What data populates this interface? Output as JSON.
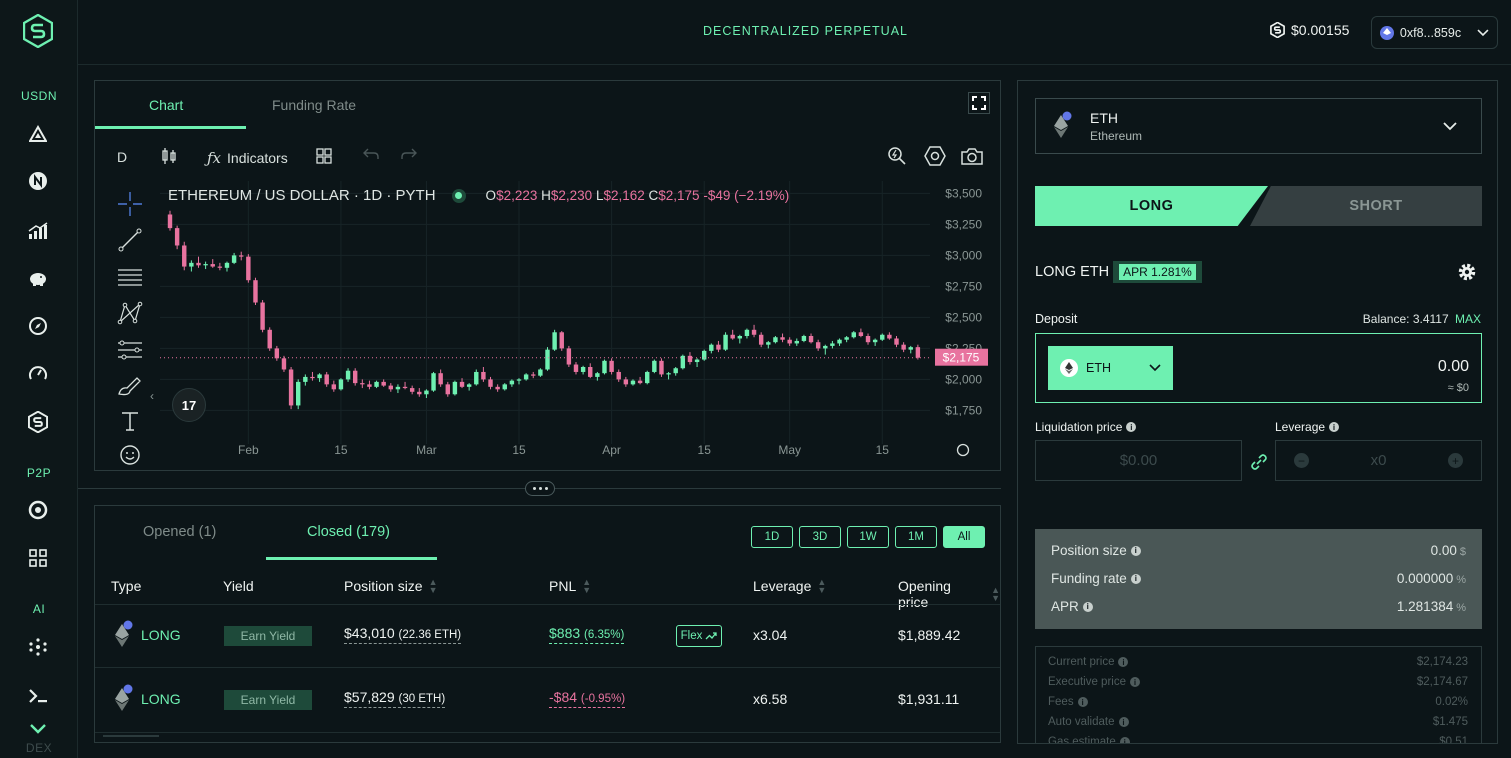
{
  "app": {
    "title": "DECENTRALIZED PERPETUAL",
    "balance": "$0.00155",
    "wallet": "0xf8...859c"
  },
  "sidebar": {
    "sections": [
      "USDN",
      "P2P",
      "AI",
      "DEX"
    ]
  },
  "chart_panel": {
    "tabs": [
      "Chart",
      "Funding Rate"
    ],
    "active_tab": "Chart",
    "toolbar": {
      "interval": "D",
      "indicators_label": "Indicators"
    },
    "legend": {
      "symbol": "ETHEREUM / US DOLLAR · 1D · PYTH",
      "o_label": "O",
      "o": "$2,223",
      "h_label": "H",
      "h": "$2,230",
      "l_label": "L",
      "l": "$2,162",
      "c_label": "C",
      "c": "$2,175",
      "change": "-$49 (−2.19%)"
    },
    "price_tag": "$2,175",
    "tv_logo": "17"
  },
  "chart_data": {
    "type": "candlestick",
    "title": "ETHEREUM / US DOLLAR · 1D · PYTH",
    "y_ticks": [
      "$3,500",
      "$3,250",
      "$3,000",
      "$2,750",
      "$2,500",
      "$2,250",
      "$2,000",
      "$1,750"
    ],
    "y_tick_values": [
      3500,
      3250,
      3000,
      2750,
      2500,
      2250,
      2000,
      1750
    ],
    "x_ticks": [
      "Feb",
      "15",
      "Mar",
      "15",
      "Apr",
      "15",
      "May",
      "15"
    ],
    "ylim": [
      1600,
      3600
    ],
    "current_price": 2175,
    "up_color": "#6ef0b1",
    "down_color": "#e8739f",
    "candles": [
      [
        3330,
        3360,
        3200,
        3220
      ],
      [
        3220,
        3240,
        3050,
        3080
      ],
      [
        3080,
        3110,
        2880,
        2910
      ],
      [
        2910,
        2960,
        2870,
        2940
      ],
      [
        2940,
        2990,
        2900,
        2920
      ],
      [
        2920,
        2950,
        2890,
        2930
      ],
      [
        2930,
        2970,
        2900,
        2910
      ],
      [
        2910,
        2940,
        2880,
        2900
      ],
      [
        2900,
        2950,
        2870,
        2940
      ],
      [
        2940,
        3020,
        2930,
        3000
      ],
      [
        3000,
        3030,
        2960,
        2990
      ],
      [
        2990,
        3010,
        2780,
        2800
      ],
      [
        2800,
        2820,
        2600,
        2620
      ],
      [
        2620,
        2640,
        2380,
        2400
      ],
      [
        2400,
        2420,
        2230,
        2250
      ],
      [
        2250,
        2270,
        2150,
        2170
      ],
      [
        2170,
        2190,
        2060,
        2080
      ],
      [
        2080,
        2100,
        1760,
        1790
      ],
      [
        1790,
        2000,
        1760,
        1980
      ],
      [
        1980,
        2040,
        1950,
        2020
      ],
      [
        2020,
        2060,
        1990,
        2010
      ],
      [
        2010,
        2050,
        1980,
        2040
      ],
      [
        2040,
        2060,
        1940,
        1960
      ],
      [
        1960,
        1990,
        1900,
        1920
      ],
      [
        1920,
        2010,
        1910,
        2000
      ],
      [
        2000,
        2090,
        1980,
        2070
      ],
      [
        2070,
        2090,
        1950,
        1970
      ],
      [
        1970,
        2000,
        1930,
        1960
      ],
      [
        1960,
        1990,
        1920,
        1940
      ],
      [
        1940,
        1990,
        1930,
        1980
      ],
      [
        1980,
        2000,
        1940,
        1950
      ],
      [
        1950,
        1970,
        1900,
        1920
      ],
      [
        1920,
        1960,
        1890,
        1940
      ],
      [
        1940,
        1980,
        1920,
        1930
      ],
      [
        1930,
        1950,
        1880,
        1900
      ],
      [
        1900,
        1930,
        1860,
        1880
      ],
      [
        1880,
        1920,
        1850,
        1910
      ],
      [
        1910,
        2060,
        1900,
        2050
      ],
      [
        2050,
        2080,
        1940,
        1960
      ],
      [
        1960,
        1980,
        1860,
        1880
      ],
      [
        1880,
        1990,
        1870,
        1980
      ],
      [
        1980,
        2010,
        1930,
        1940
      ],
      [
        1940,
        1970,
        1910,
        1960
      ],
      [
        1960,
        2080,
        1950,
        2060
      ],
      [
        2060,
        2100,
        1980,
        2000
      ],
      [
        2000,
        2020,
        1920,
        1940
      ],
      [
        1940,
        1960,
        1900,
        1920
      ],
      [
        1920,
        1970,
        1910,
        1960
      ],
      [
        1960,
        2000,
        1940,
        1990
      ],
      [
        1990,
        2010,
        1960,
        2000
      ],
      [
        2000,
        2050,
        1990,
        2040
      ],
      [
        2040,
        2060,
        2010,
        2030
      ],
      [
        2030,
        2090,
        2020,
        2080
      ],
      [
        2080,
        2260,
        2070,
        2240
      ],
      [
        2240,
        2400,
        2230,
        2380
      ],
      [
        2380,
        2390,
        2230,
        2250
      ],
      [
        2250,
        2270,
        2100,
        2120
      ],
      [
        2120,
        2140,
        2040,
        2060
      ],
      [
        2060,
        2110,
        2040,
        2100
      ],
      [
        2100,
        2130,
        2010,
        2020
      ],
      [
        2020,
        2060,
        1990,
        2050
      ],
      [
        2050,
        2160,
        2040,
        2150
      ],
      [
        2150,
        2170,
        2040,
        2060
      ],
      [
        2060,
        2080,
        1980,
        2000
      ],
      [
        2000,
        2020,
        1940,
        1960
      ],
      [
        1960,
        2000,
        1950,
        1990
      ],
      [
        1990,
        2020,
        1960,
        1970
      ],
      [
        1970,
        2070,
        1960,
        2060
      ],
      [
        2060,
        2160,
        2050,
        2150
      ],
      [
        2150,
        2170,
        2020,
        2040
      ],
      [
        2040,
        2060,
        2000,
        2050
      ],
      [
        2050,
        2100,
        2030,
        2090
      ],
      [
        2090,
        2200,
        2080,
        2190
      ],
      [
        2190,
        2220,
        2120,
        2140
      ],
      [
        2140,
        2170,
        2100,
        2160
      ],
      [
        2160,
        2240,
        2150,
        2230
      ],
      [
        2230,
        2290,
        2210,
        2280
      ],
      [
        2280,
        2310,
        2220,
        2240
      ],
      [
        2240,
        2380,
        2230,
        2360
      ],
      [
        2360,
        2400,
        2320,
        2330
      ],
      [
        2330,
        2360,
        2290,
        2350
      ],
      [
        2350,
        2410,
        2330,
        2400
      ],
      [
        2400,
        2440,
        2340,
        2360
      ],
      [
        2360,
        2380,
        2260,
        2280
      ],
      [
        2280,
        2310,
        2250,
        2300
      ],
      [
        2300,
        2350,
        2290,
        2340
      ],
      [
        2340,
        2370,
        2300,
        2320
      ],
      [
        2320,
        2340,
        2270,
        2290
      ],
      [
        2290,
        2330,
        2270,
        2310
      ],
      [
        2310,
        2360,
        2300,
        2350
      ],
      [
        2350,
        2370,
        2290,
        2300
      ],
      [
        2300,
        2320,
        2230,
        2250
      ],
      [
        2250,
        2280,
        2200,
        2270
      ],
      [
        2270,
        2310,
        2250,
        2290
      ],
      [
        2290,
        2330,
        2270,
        2320
      ],
      [
        2320,
        2350,
        2300,
        2340
      ],
      [
        2340,
        2390,
        2330,
        2380
      ],
      [
        2380,
        2410,
        2340,
        2350
      ],
      [
        2350,
        2370,
        2280,
        2300
      ],
      [
        2300,
        2330,
        2270,
        2320
      ],
      [
        2320,
        2370,
        2310,
        2360
      ],
      [
        2360,
        2380,
        2320,
        2330
      ],
      [
        2330,
        2350,
        2260,
        2280
      ],
      [
        2280,
        2300,
        2220,
        2240
      ],
      [
        2240,
        2270,
        2210,
        2260
      ],
      [
        2260,
        2280,
        2160,
        2175
      ]
    ]
  },
  "positions": {
    "tabs": [
      "Opened (1)",
      "Closed (179)"
    ],
    "active_tab": "Closed (179)",
    "filters": [
      "1D",
      "3D",
      "1W",
      "1M",
      "All"
    ],
    "active_filter": "All",
    "columns": [
      "Type",
      "Yield",
      "Position size",
      "PNL",
      "Leverage",
      "Opening price"
    ],
    "rows": [
      {
        "type": "LONG",
        "yield": "Earn Yield",
        "size": "$43,010",
        "size_eth": "(22.36 ETH)",
        "pnl": "$883",
        "pnl_pct": "(6.35%)",
        "pnl_positive": true,
        "flex": "Flex",
        "leverage": "x3.04",
        "opening": "$1,889.42"
      },
      {
        "type": "LONG",
        "yield": "Earn Yield",
        "size": "$57,829",
        "size_eth": "(30 ETH)",
        "pnl": "-$84",
        "pnl_pct": "(-0.95%)",
        "pnl_positive": false,
        "flex": "",
        "leverage": "x6.58",
        "opening": "$1,931.11"
      }
    ]
  },
  "trade": {
    "asset": {
      "symbol": "ETH",
      "name": "Ethereum"
    },
    "long_label": "LONG",
    "short_label": "SHORT",
    "heading": "LONG ETH",
    "apr_badge": "APR 1.281%",
    "deposit_label": "Deposit",
    "balance_label": "Balance: 3.4117",
    "max_label": "MAX",
    "deposit_token": "ETH",
    "deposit_value": "0.00",
    "deposit_usd": "≈ $0",
    "liq_label": "Liquidation price",
    "liq_placeholder": "$0.00",
    "lev_label": "Leverage",
    "lev_placeholder": "x0",
    "summary": [
      {
        "label": "Position size",
        "value": "0.00",
        "unit": "$"
      },
      {
        "label": "Funding rate",
        "value": "0.000000",
        "unit": "%"
      },
      {
        "label": "APR",
        "value": "1.281384",
        "unit": "%"
      }
    ],
    "details": [
      {
        "label": "Current price",
        "value": "$2,174.23"
      },
      {
        "label": "Executive price",
        "value": "$2,174.67"
      },
      {
        "label": "Fees",
        "value": "0.02%"
      },
      {
        "label": "Auto validate",
        "value": "$1.475"
      },
      {
        "label": "Gas estimate",
        "value": "$0.51"
      }
    ]
  },
  "colors": {
    "accent": "#6ef0b1",
    "negative": "#e8739f",
    "bg": "#0c1518"
  }
}
